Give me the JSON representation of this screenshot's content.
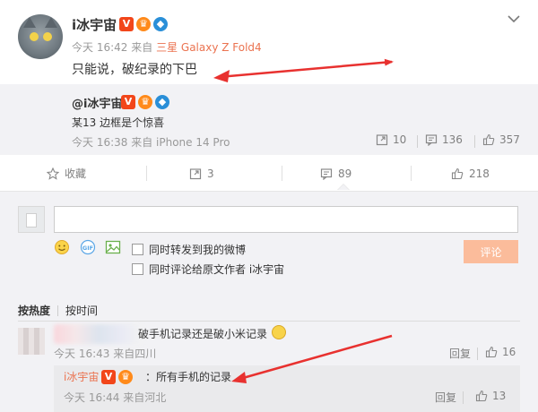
{
  "post": {
    "author": "i冰宇宙",
    "time": "今天 16:42",
    "source_prefix": "来自",
    "device": "三星 Galaxy Z Fold4",
    "text": "只能说，破纪录的下巴"
  },
  "repost": {
    "author": "@i冰宇宙",
    "text": "某13 边框是个惊喜",
    "meta": "今天 16:38 来自 iPhone 14 Pro",
    "forward_count": "10",
    "comment_count": "136",
    "like_count": "357"
  },
  "actions": {
    "favorite_label": "收藏",
    "forward_count": "3",
    "comment_count": "89",
    "like_count": "218"
  },
  "comment_box": {
    "placeholder": "",
    "checkbox1_label": "同时转发到我的微博",
    "checkbox2_label": "同时评论给原文作者 i冰宇宙",
    "submit_label": "评论"
  },
  "sort": {
    "hot": "按热度",
    "time": "按时间"
  },
  "comments": [
    {
      "text": "破手机记录还是破小米记录",
      "meta": "今天 16:43 来自四川",
      "reply_label": "回复",
      "like_count": "16",
      "reply": {
        "author": "i冰宇宙",
        "text": "：所有手机的记录",
        "meta": "今天 16:44 来自河北",
        "reply_label": "回复",
        "like_count": "13"
      }
    }
  ],
  "colors": {
    "accent": "#eb7350",
    "annotation_arrow": "#e8312f",
    "submit_bg": "#fbbc9b",
    "gray_bg": "#f2f2f5"
  },
  "icons": {
    "favorite": "star-icon",
    "forward": "forward-icon",
    "comment": "comment-icon",
    "like": "thumbs-up-icon",
    "menu": "chevron-down-icon"
  }
}
